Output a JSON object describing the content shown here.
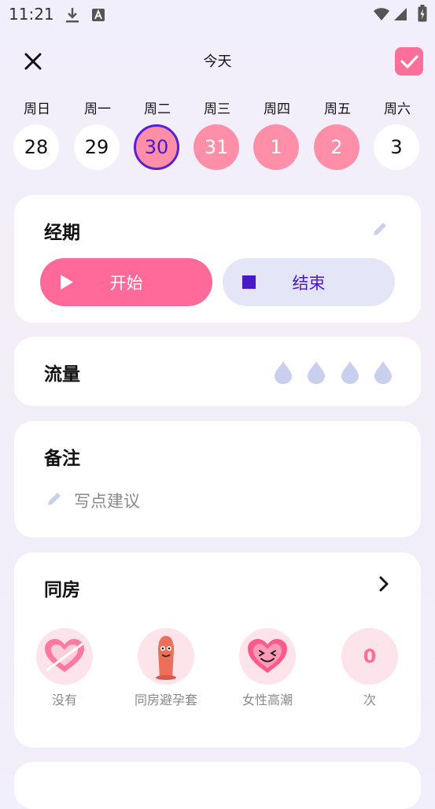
{
  "status_bar": {
    "time": "11:21"
  },
  "header": {
    "title": "今天"
  },
  "week": [
    {
      "label": "周日",
      "day": "28",
      "state": "normal"
    },
    {
      "label": "周一",
      "day": "29",
      "state": "normal"
    },
    {
      "label": "周二",
      "day": "30",
      "state": "today"
    },
    {
      "label": "周三",
      "day": "31",
      "state": "period"
    },
    {
      "label": "周四",
      "day": "1",
      "state": "period"
    },
    {
      "label": "周五",
      "day": "2",
      "state": "period"
    },
    {
      "label": "周六",
      "day": "3",
      "state": "normal"
    }
  ],
  "period": {
    "title": "经期",
    "start_label": "开始",
    "end_label": "结束"
  },
  "flow": {
    "title": "流量"
  },
  "notes": {
    "title": "备注",
    "placeholder": "写点建议"
  },
  "intimacy": {
    "title": "同房",
    "options": [
      {
        "label": "没有",
        "icon": "broken-heart-icon"
      },
      {
        "label": "同房避孕套",
        "icon": "condom-icon"
      },
      {
        "label": "女性高潮",
        "icon": "happy-heart-icon"
      },
      {
        "label": "次",
        "value": "0"
      }
    ]
  },
  "colors": {
    "accent": "#ff6f9b",
    "primary": "#4b18c7",
    "period": "#ff8fa8",
    "drop": "#c8d0ee"
  }
}
